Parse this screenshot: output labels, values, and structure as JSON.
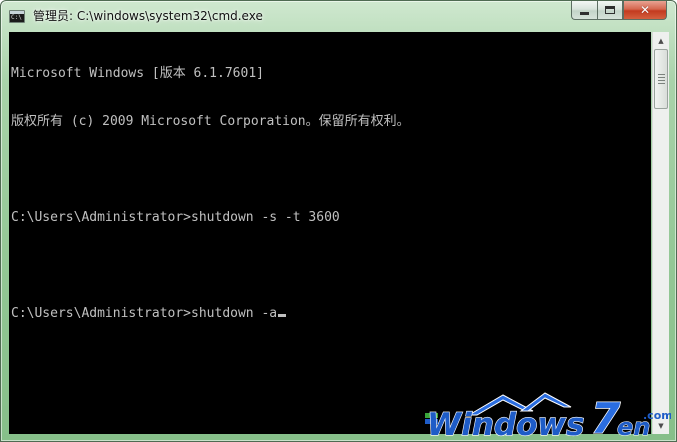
{
  "window": {
    "title": "管理员: C:\\windows\\system32\\cmd.exe",
    "icon": "console-icon",
    "icon_label": "C:\\",
    "minimize_glyph": "minimize-icon",
    "maximize_glyph": "maximize-icon",
    "close_glyph": "✕"
  },
  "console": {
    "foreground": "#c0c0c0",
    "background": "#000000",
    "lines": [
      "Microsoft Windows [版本 6.1.7601]",
      "版权所有 (c) 2009 Microsoft Corporation。保留所有权利。",
      "",
      "C:\\Users\\Administrator>shutdown -s -t 3600",
      "",
      "C:\\Users\\Administrator>shutdown -a"
    ]
  },
  "scrollbar": {
    "up_arrow": "▲",
    "down_arrow": "▼"
  },
  "watermark": {
    "brand": "Windows",
    "seven": "7",
    "suffix": "en",
    "domain": ".com",
    "colors": {
      "primary": "#1e5cc7",
      "accent": "#2a6de0"
    }
  }
}
